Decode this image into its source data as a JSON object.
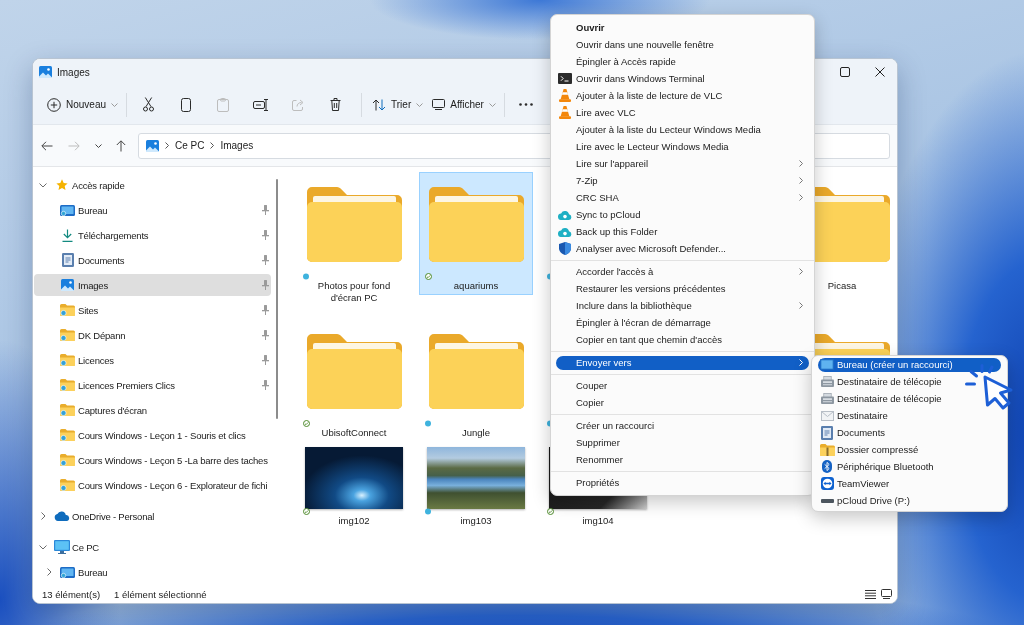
{
  "window": {
    "title": "Images"
  },
  "toolbar": {
    "groups": [
      [
        {
          "kind": "new",
          "label": "Nouveau",
          "disabled": false
        }
      ],
      [
        {
          "kind": "cut",
          "disabled": false
        },
        {
          "kind": "copy",
          "disabled": false
        },
        {
          "kind": "paste",
          "disabled": true
        },
        {
          "kind": "rename",
          "disabled": false
        },
        {
          "kind": "share",
          "disabled": true
        },
        {
          "kind": "delete",
          "disabled": false
        }
      ],
      [
        {
          "kind": "sort",
          "label": "Trier",
          "disabled": false
        },
        {
          "kind": "view",
          "label": "Afficher",
          "disabled": false
        }
      ],
      [
        {
          "kind": "more",
          "disabled": false
        }
      ]
    ]
  },
  "navigation": {
    "buttons": [
      {
        "kind": "back",
        "disabled": false
      },
      {
        "kind": "forward",
        "disabled": true
      },
      {
        "kind": "recent",
        "disabled": false
      },
      {
        "kind": "up",
        "disabled": false
      }
    ]
  },
  "address_bar": {
    "path": [
      "Ce PC",
      "Images"
    ]
  },
  "sidebar": {
    "items": [
      {
        "label": "Accès rapide",
        "kind": "star",
        "expanded": true,
        "selected": false,
        "children": [
          {
            "label": "Bureau",
            "kind": "desktop",
            "pinned": true,
            "selected": false
          },
          {
            "label": "Téléchargements",
            "kind": "downloads",
            "pinned": true,
            "selected": false
          },
          {
            "label": "Documents",
            "kind": "documents",
            "pinned": true,
            "selected": false
          },
          {
            "label": "Images",
            "kind": "pictures",
            "pinned": true,
            "selected": true
          },
          {
            "label": "Sites",
            "kind": "folder",
            "pinned": true,
            "selected": false
          },
          {
            "label": "DK Dépann",
            "kind": "folder",
            "pinned": true,
            "selected": false
          },
          {
            "label": "Licences",
            "kind": "folder",
            "pinned": true,
            "selected": false
          },
          {
            "label": "Licences Premiers Clics",
            "kind": "folder",
            "pinned": true,
            "selected": false
          },
          {
            "label": "Captures d'écran",
            "kind": "folder",
            "pinned": false,
            "selected": false
          },
          {
            "label": "Cours Windows - Leçon 1 - Souris et clics",
            "kind": "folder",
            "pinned": false,
            "selected": false
          },
          {
            "label": "Cours Windows - Leçon 5 -La barre des taches",
            "kind": "folder",
            "pinned": false,
            "selected": false
          },
          {
            "label": "Cours Windows - Leçon 6 - Explorateur de fichi",
            "kind": "folder",
            "pinned": false,
            "selected": false
          }
        ]
      },
      {
        "label": "OneDrive - Personal",
        "kind": "onedrive",
        "expanded": false,
        "selected": false
      },
      {
        "label": "Ce PC",
        "kind": "pc",
        "expanded": true,
        "selected": false,
        "children": [
          {
            "label": "Bureau",
            "kind": "desktop",
            "expanded": false,
            "selected": false
          }
        ]
      }
    ]
  },
  "items": [
    {
      "name": "Photos pour fond d'écran PC",
      "kind": "folder",
      "synced": false,
      "selected": false
    },
    {
      "name": "aquariums",
      "kind": "folder",
      "synced": true,
      "selected": true
    },
    {
      "synced": false
    },
    {
      "name": "UbisoftConnect",
      "kind": "folder",
      "synced": true,
      "selected": false
    },
    {
      "name": "Jungle",
      "kind": "folder",
      "synced": false,
      "selected": false
    },
    {
      "synced": false
    },
    {
      "name": "img102",
      "kind": "photo",
      "synced": true,
      "selected": false
    },
    {
      "name": "img103",
      "kind": "photo",
      "synced": false,
      "selected": false
    },
    {
      "name": "img104",
      "kind": "photo",
      "synced": true,
      "selected": false
    }
  ],
  "right_column_items": [
    {
      "name": "Picasa",
      "kind": "folder",
      "selected": false
    },
    {
      "kind": "folder"
    }
  ],
  "status_bar": {
    "item_count": "13 élément(s)",
    "selection": "1 élément sélectionné"
  },
  "context_menu": {
    "groups": [
      [
        {
          "label": "Ouvrir",
          "kind": "none",
          "default": true,
          "submenu": false,
          "selected": false
        },
        {
          "label": "Ouvrir dans une nouvelle fenêtre",
          "kind": "none",
          "default": false,
          "submenu": false,
          "selected": false
        },
        {
          "label": "Épingler à Accès rapide",
          "kind": "none",
          "default": false,
          "submenu": false,
          "selected": false
        },
        {
          "label": "Ouvrir dans Windows Terminal",
          "kind": "terminal",
          "default": false,
          "submenu": false,
          "selected": false
        },
        {
          "label": "Ajouter à la liste de lecture de VLC",
          "kind": "cone",
          "default": false,
          "submenu": false,
          "selected": false
        },
        {
          "label": "Lire avec VLC",
          "kind": "cone",
          "default": false,
          "submenu": false,
          "selected": false
        },
        {
          "label": "Ajouter à la liste du Lecteur Windows Media",
          "kind": "none",
          "default": false,
          "submenu": false,
          "selected": false
        },
        {
          "label": "Lire avec le Lecteur Windows Media",
          "kind": "none",
          "default": false,
          "submenu": false,
          "selected": false
        },
        {
          "label": "Lire sur l'appareil",
          "kind": "none",
          "default": false,
          "submenu": true,
          "selected": false
        },
        {
          "label": "7-Zip",
          "kind": "none",
          "default": false,
          "submenu": true,
          "selected": false
        },
        {
          "label": "CRC SHA",
          "kind": "none",
          "default": false,
          "submenu": true,
          "selected": false
        },
        {
          "label": "Sync to pCloud",
          "kind": "cloud",
          "default": false,
          "submenu": false,
          "selected": false
        },
        {
          "label": "Back up this Folder",
          "kind": "cloud",
          "default": false,
          "submenu": false,
          "selected": false
        },
        {
          "label": "Analyser avec Microsoft Defender...",
          "kind": "shield",
          "default": false,
          "submenu": false,
          "selected": false
        }
      ],
      [
        {
          "label": "Accorder l'accès à",
          "kind": "none",
          "default": false,
          "submenu": true,
          "selected": false
        },
        {
          "label": "Restaurer les versions précédentes",
          "kind": "none",
          "default": false,
          "submenu": false,
          "selected": false
        },
        {
          "label": "Inclure dans la bibliothèque",
          "kind": "none",
          "default": false,
          "submenu": true,
          "selected": false
        },
        {
          "label": "Épingler à l'écran de démarrage",
          "kind": "none",
          "default": false,
          "submenu": false,
          "selected": false
        },
        {
          "label": "Copier en tant que chemin d'accès",
          "kind": "none",
          "default": false,
          "submenu": false,
          "selected": false
        }
      ],
      [
        {
          "label": "Envoyer vers",
          "kind": "none",
          "default": false,
          "submenu": true,
          "selected": true
        }
      ],
      [
        {
          "label": "Couper",
          "kind": "none",
          "default": false,
          "submenu": false,
          "selected": false
        },
        {
          "label": "Copier",
          "kind": "none",
          "default": false,
          "submenu": false,
          "selected": false
        }
      ],
      [
        {
          "label": "Créer un raccourci",
          "kind": "none",
          "default": false,
          "submenu": false,
          "selected": false
        },
        {
          "label": "Supprimer",
          "kind": "none",
          "default": false,
          "submenu": false,
          "selected": false
        },
        {
          "label": "Renommer",
          "kind": "none",
          "default": false,
          "submenu": false,
          "selected": false
        }
      ],
      [
        {
          "label": "Propriétés",
          "kind": "none",
          "default": false,
          "submenu": false,
          "selected": false
        }
      ]
    ]
  },
  "send_to_menu": {
    "items": [
      {
        "label": "Bureau (créer un raccourci)",
        "kind": "desktop",
        "selected": true
      },
      {
        "label": "Destinataire de télécopie",
        "kind": "fax",
        "selected": false
      },
      {
        "label": "Destinataire de télécopie",
        "kind": "fax",
        "selected": false
      },
      {
        "label": "Destinataire",
        "kind": "mail",
        "selected": false
      },
      {
        "label": "Documents",
        "kind": "documents",
        "selected": false
      },
      {
        "label": "Dossier compressé",
        "kind": "zip",
        "selected": false
      },
      {
        "label": "Périphérique Bluetooth",
        "kind": "bluetooth",
        "selected": false
      },
      {
        "label": "TeamViewer",
        "kind": "remote",
        "selected": false
      },
      {
        "label": "pCloud Drive (P:)",
        "kind": "drive",
        "selected": false
      }
    ]
  }
}
